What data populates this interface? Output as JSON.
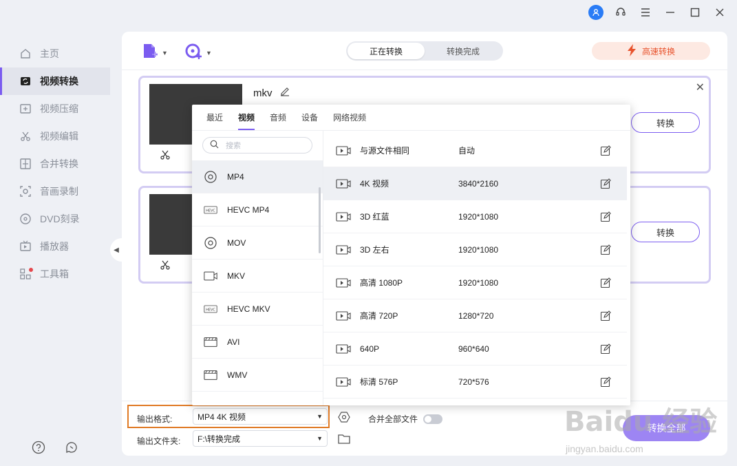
{
  "sidebar": {
    "items": [
      {
        "label": "主页",
        "icon": "home-icon"
      },
      {
        "label": "视频转换",
        "icon": "convert-icon",
        "active": true
      },
      {
        "label": "视频压缩",
        "icon": "compress-icon"
      },
      {
        "label": "视频编辑",
        "icon": "scissors-icon"
      },
      {
        "label": "合并转换",
        "icon": "merge-icon"
      },
      {
        "label": "音画录制",
        "icon": "record-icon"
      },
      {
        "label": "DVD刻录",
        "icon": "disc-icon"
      },
      {
        "label": "播放器",
        "icon": "player-icon"
      },
      {
        "label": "工具箱",
        "icon": "toolbox-icon"
      }
    ]
  },
  "toolbar": {
    "tabs": [
      "正在转换",
      "转换完成"
    ],
    "speed_label": "高速转换"
  },
  "files": [
    {
      "name": "mkv",
      "convert_label": "转换"
    },
    {
      "convert_label": "转换"
    }
  ],
  "popup": {
    "tabs": [
      "最近",
      "视频",
      "音频",
      "设备",
      "网络视频"
    ],
    "search_placeholder": "搜索",
    "formats": [
      "MP4",
      "HEVC MP4",
      "MOV",
      "MKV",
      "HEVC MKV",
      "AVI",
      "WMV"
    ],
    "qualities": [
      {
        "name": "与源文件相同",
        "res": "自动"
      },
      {
        "name": "4K 视频",
        "res": "3840*2160"
      },
      {
        "name": "3D 红蓝",
        "res": "1920*1080"
      },
      {
        "name": "3D 左右",
        "res": "1920*1080"
      },
      {
        "name": "高清 1080P",
        "res": "1920*1080"
      },
      {
        "name": "高清 720P",
        "res": "1280*720"
      },
      {
        "name": "640P",
        "res": "960*640"
      },
      {
        "name": "标清 576P",
        "res": "720*576"
      }
    ]
  },
  "bottom": {
    "format_label": "输出格式:",
    "format_value": "MP4 4K 视频",
    "folder_label": "输出文件夹:",
    "folder_value": "F:\\转换完成",
    "merge_label": "合并全部文件",
    "convert_all": "转换全部"
  },
  "watermark": {
    "text": "Baidu 经验",
    "url": "jingyan.baidu.com"
  },
  "colors": {
    "accent": "#7b5cf0",
    "highlight_border": "#e07a25",
    "speed": "#e8532d"
  }
}
